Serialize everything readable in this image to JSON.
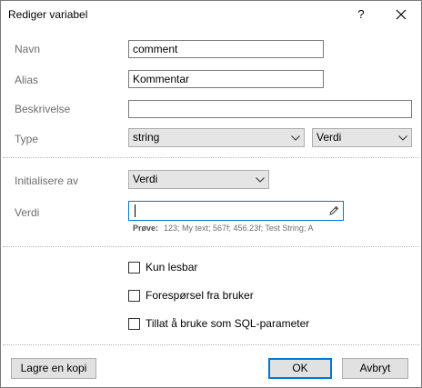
{
  "window": {
    "title": "Rediger variabel",
    "help_label": "?"
  },
  "form": {
    "navn_label": "Navn",
    "navn_value": "comment",
    "alias_label": "Alias",
    "alias_value": "Kommentar",
    "beskrivelse_label": "Beskrivelse",
    "beskrivelse_value": "",
    "type_label": "Type",
    "type_value": "string",
    "type_mode_value": "Verdi",
    "init_label": "Initialisere av",
    "init_value": "Verdi",
    "verdi_label": "Verdi",
    "verdi_value": "",
    "sample_label": "Prøve:",
    "sample_text": "123; My text; 567f; 456.23f; Test String; A"
  },
  "options": {
    "readonly_label": "Kun lesbar",
    "request_label": "Forespørsel fra bruker",
    "sql_label": "Tillat å bruke som SQL-parameter",
    "readonly_checked": false,
    "request_checked": false,
    "sql_checked": false
  },
  "buttons": {
    "save_copy": "Lagre en kopi",
    "ok": "OK",
    "cancel": "Avbryt"
  },
  "colors": {
    "accent": "#0078d7",
    "label_gray": "#6d6d6d",
    "button_face": "#e1e1e1"
  }
}
